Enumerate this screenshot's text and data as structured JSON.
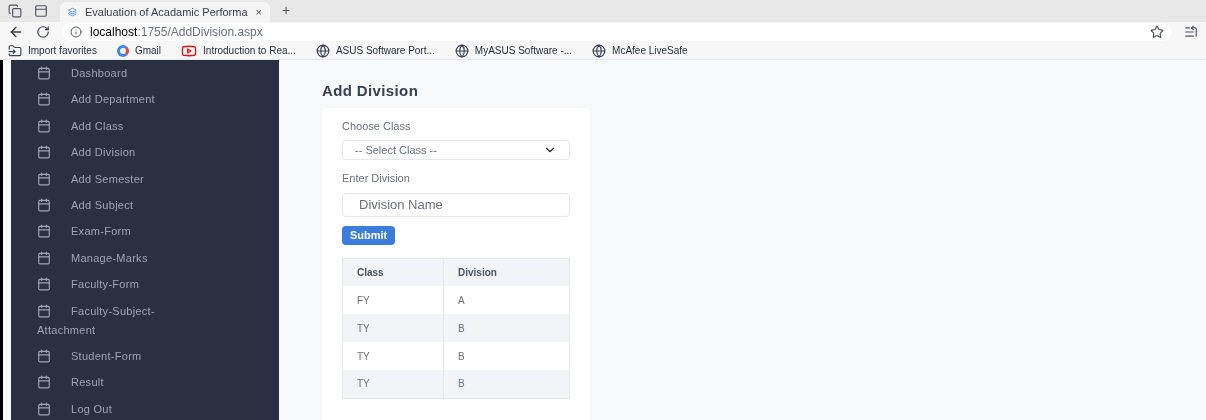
{
  "browser": {
    "tab": {
      "title": "Evaluation of Acadamic Performa",
      "close": "×"
    },
    "new_tab": "+",
    "address": {
      "host": "localhost",
      "path": ":1755/AddDivision.aspx"
    },
    "bookmarks": [
      {
        "label": "Import favorites",
        "kind": "import"
      },
      {
        "label": "Gmail",
        "kind": "gmail"
      },
      {
        "label": "Introduction to Rea...",
        "kind": "video"
      },
      {
        "label": "ASUS Software Port...",
        "kind": "globe"
      },
      {
        "label": "MyASUS Software -...",
        "kind": "globe"
      },
      {
        "label": "McAfee LiveSafe",
        "kind": "globe"
      }
    ]
  },
  "sidebar": {
    "items": [
      {
        "label": "Dashboard"
      },
      {
        "label": "Add Department"
      },
      {
        "label": "Add Class"
      },
      {
        "label": "Add Division"
      },
      {
        "label": "Add Semester"
      },
      {
        "label": "Add Subject"
      },
      {
        "label": "Exam-Form"
      },
      {
        "label": "Manage-Marks"
      },
      {
        "label": "Faculty-Form"
      },
      {
        "label": "Faculty-Subject-Attachment"
      },
      {
        "label": "Student-Form"
      },
      {
        "label": "Result"
      },
      {
        "label": "Log Out"
      }
    ]
  },
  "page": {
    "title": "Add Division",
    "class_label": "Choose Class",
    "class_select": {
      "value": "-- Select Class --"
    },
    "division_label": "Enter Division",
    "division_field": {
      "placeholder": "Division Name"
    },
    "submit": "Submit",
    "table": {
      "columns": [
        "Class",
        "Division"
      ],
      "rows": [
        [
          "FY",
          "A"
        ],
        [
          "TY",
          "B"
        ],
        [
          "TY",
          "B"
        ],
        [
          "TY",
          "B"
        ]
      ]
    }
  }
}
